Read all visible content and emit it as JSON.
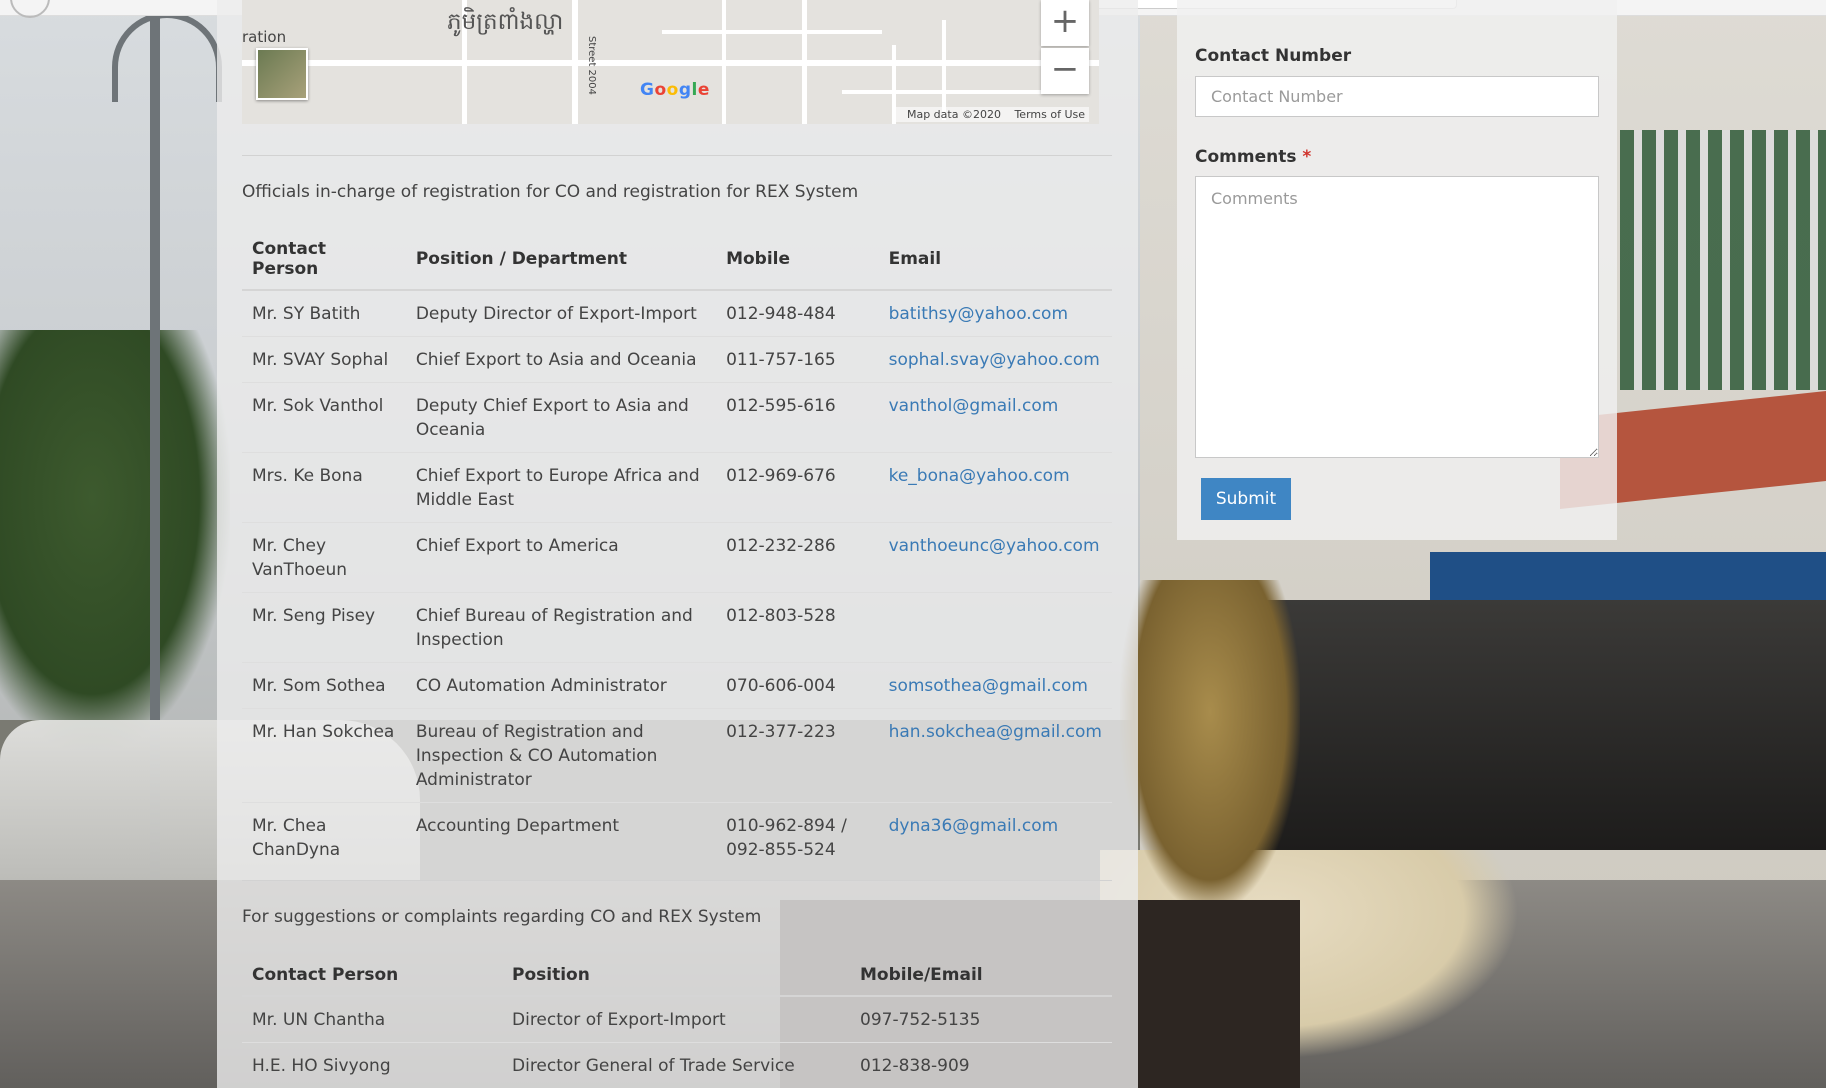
{
  "map": {
    "khmer_label": "ភូមិត្រពាំងល្ហា",
    "ration_label": "ration",
    "street_label": "Street 2004",
    "google_label": "Google",
    "zoom_in": "+",
    "zoom_out": "−",
    "map_data": "Map data ©2020",
    "terms": "Terms of Use"
  },
  "officials": {
    "intro": "Officials in-charge of registration for CO and registration for REX System",
    "headers": [
      "Contact Person",
      "Position / Department",
      "Mobile",
      "Email"
    ],
    "rows": [
      {
        "name": "Mr. SY Batith",
        "position": "Deputy Director of Export-Import",
        "mobile": "012-948-484",
        "email": "batithsy@yahoo.com"
      },
      {
        "name": "Mr. SVAY Sophal",
        "position": "Chief Export to Asia and Oceania",
        "mobile": "011-757-165",
        "email": "sophal.svay@yahoo.com"
      },
      {
        "name": "Mr. Sok Vanthol",
        "position": "Deputy Chief Export to Asia and Oceania",
        "mobile": "012-595-616",
        "email": "vanthol@gmail.com"
      },
      {
        "name": "Mrs. Ke Bona",
        "position": "Chief Export to Europe Africa and Middle East",
        "mobile": "012-969-676",
        "email": "ke_bona@yahoo.com"
      },
      {
        "name": "Mr. Chey VanThoeun",
        "position": "Chief Export to America",
        "mobile": "012-232-286",
        "email": "vanthoeunc@yahoo.com"
      },
      {
        "name": "Mr. Seng Pisey",
        "position": "Chief Bureau of Registration and Inspection",
        "mobile": "012-803-528",
        "email": ""
      },
      {
        "name": "Mr. Som Sothea",
        "position": "CO Automation Administrator",
        "mobile": "070-606-004",
        "email": "somsothea@gmail.com"
      },
      {
        "name": "Mr. Han Sokchea",
        "position": "Bureau of Registration and Inspection & CO Automation Administrator",
        "mobile": "012-377-223",
        "email": "han.sokchea@gmail.com"
      },
      {
        "name": "Mr. Chea ChanDyna",
        "position": "Accounting Department",
        "mobile": "010-962-894 / 092-855-524",
        "email": "dyna36@gmail.com"
      }
    ]
  },
  "complaints": {
    "intro": "For suggestions or complaints regarding CO and REX System",
    "headers": [
      "Contact Person",
      "Position",
      "Mobile/Email"
    ],
    "rows": [
      {
        "name": "Mr. UN Chantha",
        "position": "Director of Export-Import",
        "contact": "097-752-5135"
      },
      {
        "name": "H.E. HO Sivyong",
        "position": "Director General of Trade Service",
        "contact": "012-838-909"
      }
    ]
  },
  "form": {
    "contact_label": "Contact Number",
    "contact_placeholder": "Contact Number",
    "comments_label": "Comments",
    "required_mark": "*",
    "comments_placeholder": "Comments",
    "submit_label": "Submit"
  },
  "colors": {
    "link": "#3a7ab5",
    "button": "#3f86c4",
    "required": "#d0332c"
  }
}
